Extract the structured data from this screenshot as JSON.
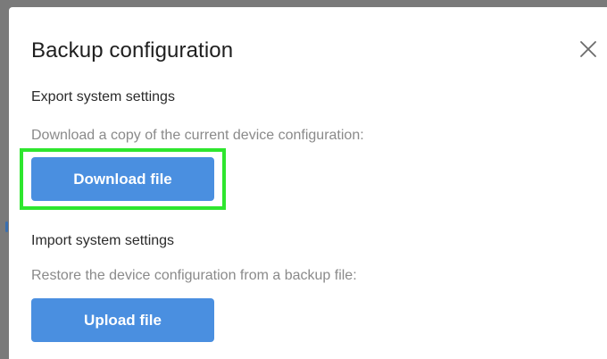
{
  "dialog": {
    "title": "Backup configuration",
    "close_icon": "close-icon"
  },
  "export": {
    "heading": "Export system settings",
    "description": "Download a copy of the current device configuration:",
    "button_label": "Download file"
  },
  "import": {
    "heading": "Import system settings",
    "description": "Restore the device configuration from a backup file:",
    "button_label": "Upload file"
  },
  "colors": {
    "overlay": "#7a7a7a",
    "dialog_background": "#ffffff",
    "primary_button": "#4a8fe0",
    "highlight_box": "#2ee62e",
    "description_text": "#8a8a8a"
  }
}
